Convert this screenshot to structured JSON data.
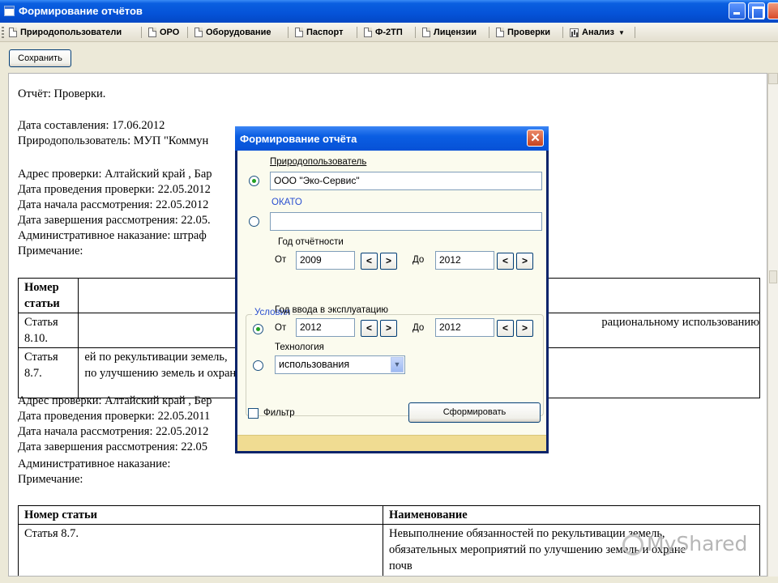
{
  "window": {
    "title": "Формирование отчётов"
  },
  "toolbar": {
    "items": [
      {
        "label": "Природопользователи"
      },
      {
        "label": "ОРО"
      },
      {
        "label": "Оборудование"
      },
      {
        "label": "Паспорт"
      },
      {
        "label": "Ф-2ТП"
      },
      {
        "label": "Лицензии"
      },
      {
        "label": "Проверки"
      },
      {
        "label": "Анализ"
      }
    ],
    "save_label": "Сохранить"
  },
  "report": {
    "lines": [
      "Отчёт: Проверки.",
      "Дата составления: 17.06.2012",
      "Природопользователь: МУП \"Коммун",
      "Адрес проверки: Алтайский край , Бар",
      "Дата проведения проверки: 22.05.2012",
      "Дата начала рассмотрения: 22.05.2012",
      "Дата завершения рассмотрения: 22.05.",
      "Административное наказание: штраф",
      "Примечание:"
    ],
    "table1": {
      "header": [
        "Номер статьи",
        ""
      ],
      "rows": [
        [
          "Статья 8.10.",
          "рациональному использованию"
        ],
        [
          "Статья 8.7.",
          "ей по рекультивации земель,",
          "по улучшению земель и охране"
        ]
      ]
    },
    "lines2": [
      "Адрес проверки: Алтайский край , Бер",
      "Дата проведения проверки: 22.05.2011",
      "Дата начала рассмотрения: 22.05.2012",
      "Дата завершения рассмотрения: 22.05",
      "Административное наказание:",
      "Примечание:"
    ],
    "table2": {
      "header": [
        "Номер статьи",
        "Наименование"
      ],
      "rows": [
        [
          "Статья 8.7.",
          "Невыполнение обязанностей по рекультивации земель,",
          "обязательных мероприятий по улучшению земель и охране",
          "почв"
        ]
      ]
    },
    "watermark": "MyShared"
  },
  "dialog": {
    "title": "Формирование отчёта",
    "user_label": "Природопользователь",
    "user_value": "ООО \"Эко-Сервис\"",
    "okato_label": "ОКАТО",
    "okato_value": "",
    "year_label": "Год отчётности",
    "from_label": "От",
    "to_label": "До",
    "year_from": "2009",
    "year_to": "2012",
    "conditions_label": "Условия",
    "commission_label": "Год ввода в эксплуатацию",
    "comm_from": "2012",
    "comm_to": "2012",
    "tech_label": "Технология",
    "tech_value": "использования",
    "filter_label": "Фильтр",
    "submit_label": "Сформировать",
    "prev_glyph": "<",
    "next_glyph": ">",
    "close_glyph": "✕"
  }
}
